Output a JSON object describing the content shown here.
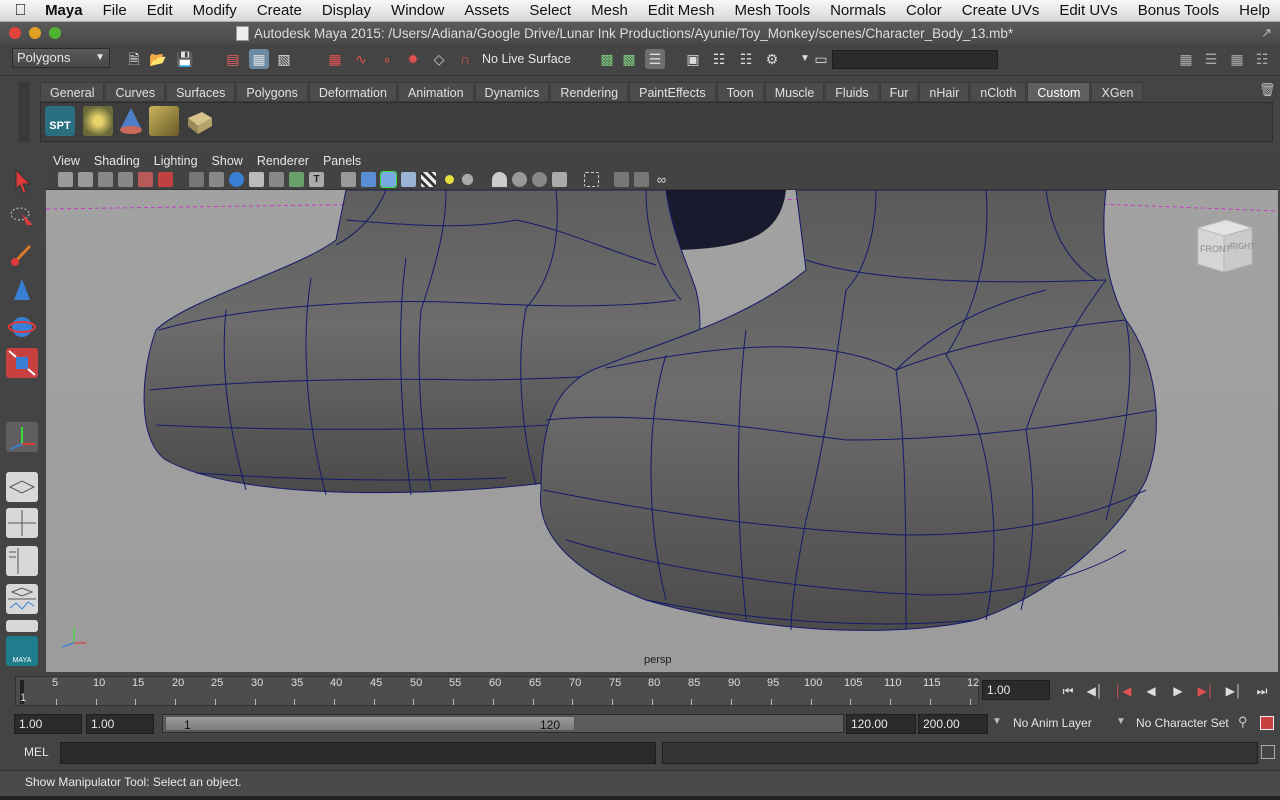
{
  "menubar": {
    "app": "Maya",
    "items": [
      "File",
      "Edit",
      "Modify",
      "Create",
      "Display",
      "Window",
      "Assets",
      "Select",
      "Mesh",
      "Edit Mesh",
      "Mesh Tools",
      "Normals",
      "Color",
      "Create UVs",
      "Edit UVs",
      "Bonus Tools",
      "Help"
    ]
  },
  "window": {
    "title": "Autodesk Maya 2015: /Users/Adiana/Google Drive/Lunar Ink Productions/Ayunie/Toy_Monkey/scenes/Character_Body_13.mb*"
  },
  "statusline": {
    "mode": "Polygons",
    "live_surface": "No Live Surface"
  },
  "shelf": {
    "tabs": [
      "General",
      "Curves",
      "Surfaces",
      "Polygons",
      "Deformation",
      "Animation",
      "Dynamics",
      "Rendering",
      "PaintEffects",
      "Toon",
      "Muscle",
      "Fluids",
      "Fur",
      "nHair",
      "nCloth",
      "Custom",
      "XGen"
    ],
    "active_tab": "Custom",
    "spt_label": "SPT"
  },
  "panel": {
    "menus": [
      "View",
      "Shading",
      "Lighting",
      "Show",
      "Renderer",
      "Panels"
    ],
    "camera": "persp",
    "viewcube_front": "FRONT",
    "viewcube_right": "RIGHT"
  },
  "timeline": {
    "ticks": [
      "5",
      "10",
      "15",
      "20",
      "25",
      "30",
      "35",
      "40",
      "45",
      "50",
      "55",
      "60",
      "65",
      "70",
      "75",
      "80",
      "85",
      "90",
      "95",
      "100",
      "105",
      "110",
      "115",
      "12"
    ],
    "current_frame_marker": "1",
    "current_time": "1.00"
  },
  "range": {
    "start": "1.00",
    "playback_start": "1.00",
    "slider_start": "1",
    "slider_end": "120",
    "playback_end": "120.00",
    "end": "200.00",
    "anim_layer": "No Anim Layer",
    "character_set": "No Character Set"
  },
  "cmdline": {
    "label": "MEL"
  },
  "helpline": {
    "text": "Show Manipulator Tool: Select an object."
  },
  "brand": {
    "maya_small": "MAYA"
  },
  "colors": {
    "wire": "#141a6a",
    "mesh": "#6c6c6c",
    "viewport_bg": "#a0a0a0",
    "active_tab": "#5f5f5f"
  }
}
